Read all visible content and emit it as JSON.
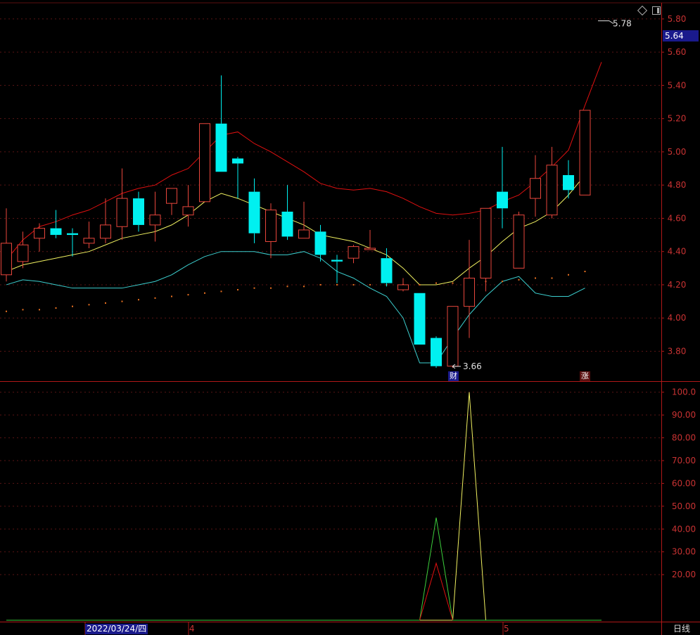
{
  "chart_data": {
    "type": "candlestick",
    "main_panel": {
      "y_ticks": [
        "5.80",
        "5.60",
        "5.40",
        "5.20",
        "5.00",
        "4.80",
        "4.60",
        "4.40",
        "4.20",
        "4.00",
        "3.80"
      ],
      "ylim": [
        3.62,
        5.88
      ],
      "current_price": "5.64",
      "high_marker": "5.78",
      "low_marker": "3.66",
      "event_badges": [
        "财",
        "涨"
      ],
      "candles": [
        {
          "open": 4.26,
          "close": 4.45,
          "high": 4.66,
          "low": 4.22
        },
        {
          "open": 4.34,
          "close": 4.44,
          "high": 4.52,
          "low": 4.3
        },
        {
          "open": 4.48,
          "close": 4.54,
          "high": 4.57,
          "low": 4.4
        },
        {
          "open": 4.54,
          "close": 4.5,
          "high": 4.65,
          "low": 4.48
        },
        {
          "open": 4.51,
          "close": 4.5,
          "high": 4.54,
          "low": 4.37
        },
        {
          "open": 4.45,
          "close": 4.48,
          "high": 4.58,
          "low": 4.42
        },
        {
          "open": 4.48,
          "close": 4.56,
          "high": 4.72,
          "low": 4.45
        },
        {
          "open": 4.55,
          "close": 4.72,
          "high": 4.9,
          "low": 4.47
        },
        {
          "open": 4.72,
          "close": 4.56,
          "high": 4.76,
          "low": 4.52
        },
        {
          "open": 4.56,
          "close": 4.62,
          "high": 4.76,
          "low": 4.46
        },
        {
          "open": 4.69,
          "close": 4.78,
          "high": 4.78,
          "low": 4.62
        },
        {
          "open": 4.62,
          "close": 4.67,
          "high": 4.8,
          "low": 4.55
        },
        {
          "open": 4.7,
          "close": 5.17,
          "high": 5.17,
          "low": 4.7
        },
        {
          "open": 5.17,
          "close": 4.88,
          "high": 5.46,
          "low": 4.88
        },
        {
          "open": 4.96,
          "close": 4.93,
          "high": 4.97,
          "low": 4.72
        },
        {
          "open": 4.76,
          "close": 4.51,
          "high": 4.84,
          "low": 4.45
        },
        {
          "open": 4.46,
          "close": 4.65,
          "high": 4.69,
          "low": 4.36
        },
        {
          "open": 4.64,
          "close": 4.49,
          "high": 4.8,
          "low": 4.47
        },
        {
          "open": 4.48,
          "close": 4.53,
          "high": 4.7,
          "low": 4.48
        },
        {
          "open": 4.52,
          "close": 4.38,
          "high": 4.56,
          "low": 4.34
        },
        {
          "open": 4.35,
          "close": 4.34,
          "high": 4.38,
          "low": 4.21
        },
        {
          "open": 4.36,
          "close": 4.43,
          "high": 4.44,
          "low": 4.33
        },
        {
          "open": 4.42,
          "close": 4.42,
          "high": 4.53,
          "low": 4.42
        },
        {
          "open": 4.36,
          "close": 4.21,
          "high": 4.42,
          "low": 4.19
        },
        {
          "open": 4.17,
          "close": 4.2,
          "high": 4.24,
          "low": 4.16
        },
        {
          "open": 4.15,
          "close": 3.84,
          "high": 4.15,
          "low": 3.84
        },
        {
          "open": 3.88,
          "close": 3.71,
          "high": 3.89,
          "low": 3.7
        },
        {
          "open": 3.71,
          "close": 4.07,
          "high": 4.07,
          "low": 3.7
        },
        {
          "open": 4.07,
          "close": 4.24,
          "high": 4.47,
          "low": 3.88
        },
        {
          "open": 4.24,
          "close": 4.66,
          "high": 4.66,
          "low": 4.16
        },
        {
          "open": 4.76,
          "close": 4.66,
          "high": 5.03,
          "low": 4.54
        },
        {
          "open": 4.3,
          "close": 4.62,
          "high": 4.64,
          "low": 4.3
        },
        {
          "open": 4.72,
          "close": 4.84,
          "high": 4.98,
          "low": 4.61
        },
        {
          "open": 4.62,
          "close": 4.92,
          "high": 5.03,
          "low": 4.6
        },
        {
          "open": 4.86,
          "close": 4.77,
          "high": 4.95,
          "low": 4.72
        },
        {
          "open": 4.74,
          "close": 5.25,
          "high": 5.25,
          "low": 4.74
        }
      ],
      "upper_band": [
        4.35,
        4.47,
        4.55,
        4.58,
        4.62,
        4.65,
        4.7,
        4.75,
        4.78,
        4.8,
        4.86,
        4.9,
        5.0,
        5.1,
        5.12,
        5.05,
        5.0,
        4.94,
        4.88,
        4.81,
        4.78,
        4.77,
        4.78,
        4.76,
        4.72,
        4.67,
        4.63,
        4.62,
        4.63,
        4.65,
        4.7,
        4.74,
        4.82,
        4.91,
        5.01,
        5.28,
        5.54
      ],
      "middle_line": [
        4.28,
        4.32,
        4.34,
        4.36,
        4.38,
        4.4,
        4.44,
        4.48,
        4.5,
        4.52,
        4.56,
        4.62,
        4.7,
        4.75,
        4.72,
        4.68,
        4.64,
        4.6,
        4.56,
        4.5,
        4.48,
        4.46,
        4.42,
        4.38,
        4.3,
        4.2,
        4.2,
        4.22,
        4.3,
        4.37,
        4.46,
        4.54,
        4.58,
        4.64,
        4.74,
        4.86
      ],
      "lower_band": [
        4.2,
        4.23,
        4.22,
        4.2,
        4.18,
        4.18,
        4.18,
        4.18,
        4.2,
        4.22,
        4.26,
        4.32,
        4.37,
        4.4,
        4.4,
        4.4,
        4.38,
        4.38,
        4.4,
        4.36,
        4.28,
        4.24,
        4.18,
        4.13,
        4.0,
        3.73,
        3.73,
        3.88,
        4.02,
        4.13,
        4.22,
        4.25,
        4.15,
        4.13,
        4.13,
        4.18
      ],
      "dots": [
        4.04,
        4.05,
        4.05,
        4.06,
        4.07,
        4.08,
        4.09,
        4.1,
        4.11,
        4.12,
        4.13,
        4.14,
        4.15,
        4.16,
        4.17,
        4.18,
        4.18,
        4.19,
        4.19,
        4.2,
        4.2,
        4.2,
        4.2,
        4.2,
        4.2,
        4.2,
        4.21,
        4.21,
        4.21,
        4.22,
        4.22,
        4.23,
        4.24,
        4.24,
        4.26,
        4.28
      ],
      "colors": {
        "up": "#e8463c",
        "down": "#00f0f0",
        "upper": "#e01010",
        "middle": "#f0f060",
        "lower": "#3ccfcf",
        "dots": "#e87020"
      }
    },
    "sub_panel": {
      "y_ticks": [
        "100.0",
        "90.00",
        "80.00",
        "70.00",
        "60.00",
        "50.00",
        "40.00",
        "30.00",
        "20.00"
      ],
      "ylim": [
        0,
        103
      ],
      "series": [
        {
          "color": "#f0f060",
          "points": [
            [
              0,
              0
            ],
            [
              27,
              0
            ],
            [
              28,
              100
            ],
            [
              29,
              0
            ],
            [
              36,
              0
            ]
          ]
        },
        {
          "color": "#3ccf3c",
          "points": [
            [
              0,
              0
            ],
            [
              25,
              0
            ],
            [
              26,
              45
            ],
            [
              27,
              0
            ],
            [
              36,
              0
            ]
          ]
        },
        {
          "color": "#e01010",
          "points": [
            [
              25,
              0
            ],
            [
              26,
              25
            ],
            [
              27,
              0
            ]
          ]
        }
      ]
    },
    "x_axis": {
      "date_label": "2022/03/24/四",
      "month_labels": [
        "4",
        "5"
      ]
    }
  },
  "period": "日线"
}
